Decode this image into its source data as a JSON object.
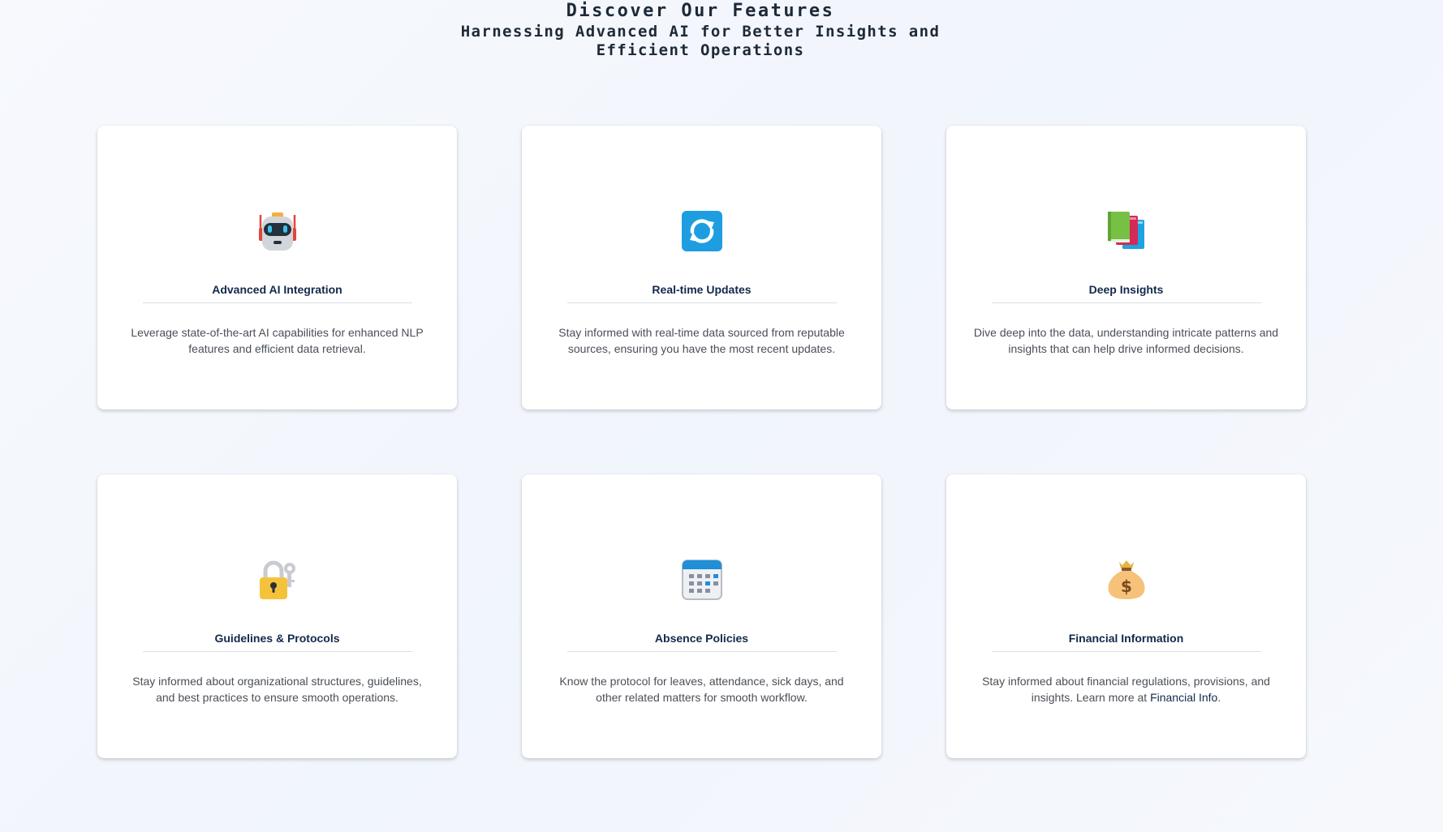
{
  "header": {
    "title": "Discover Our Features",
    "subtitle": "Harnessing Advanced AI for Better Insights and Efficient Operations"
  },
  "features": [
    {
      "icon": "robot-icon",
      "title": "Advanced AI Integration",
      "description": "Leverage state-of-the-art AI capabilities for enhanced NLP features and efficient data retrieval."
    },
    {
      "icon": "refresh-icon",
      "title": "Real-time Updates",
      "description": "Stay informed with real-time data sourced from reputable sources, ensuring you have the most recent updates."
    },
    {
      "icon": "books-icon",
      "title": "Deep Insights",
      "description": "Dive deep into the data, understanding intricate patterns and insights that can help drive informed decisions."
    },
    {
      "icon": "lock-with-key-icon",
      "title": "Guidelines & Protocols",
      "description": "Stay informed about organizational structures, guidelines, and best practices to ensure smooth operations."
    },
    {
      "icon": "calendar-icon",
      "title": "Absence Policies",
      "description": "Know the protocol for leaves, attendance, sick days, and other related matters for smooth workflow."
    },
    {
      "icon": "money-bag-icon",
      "title": "Financial Information",
      "description_prefix": "Stay informed about financial regulations, provisions, and insights. Learn more at ",
      "link_label": "Financial Info",
      "description_suffix": "."
    }
  ],
  "colors": {
    "card_title": "#13294b",
    "body_text": "#4a4f57",
    "divider": "#dcdfe4"
  }
}
